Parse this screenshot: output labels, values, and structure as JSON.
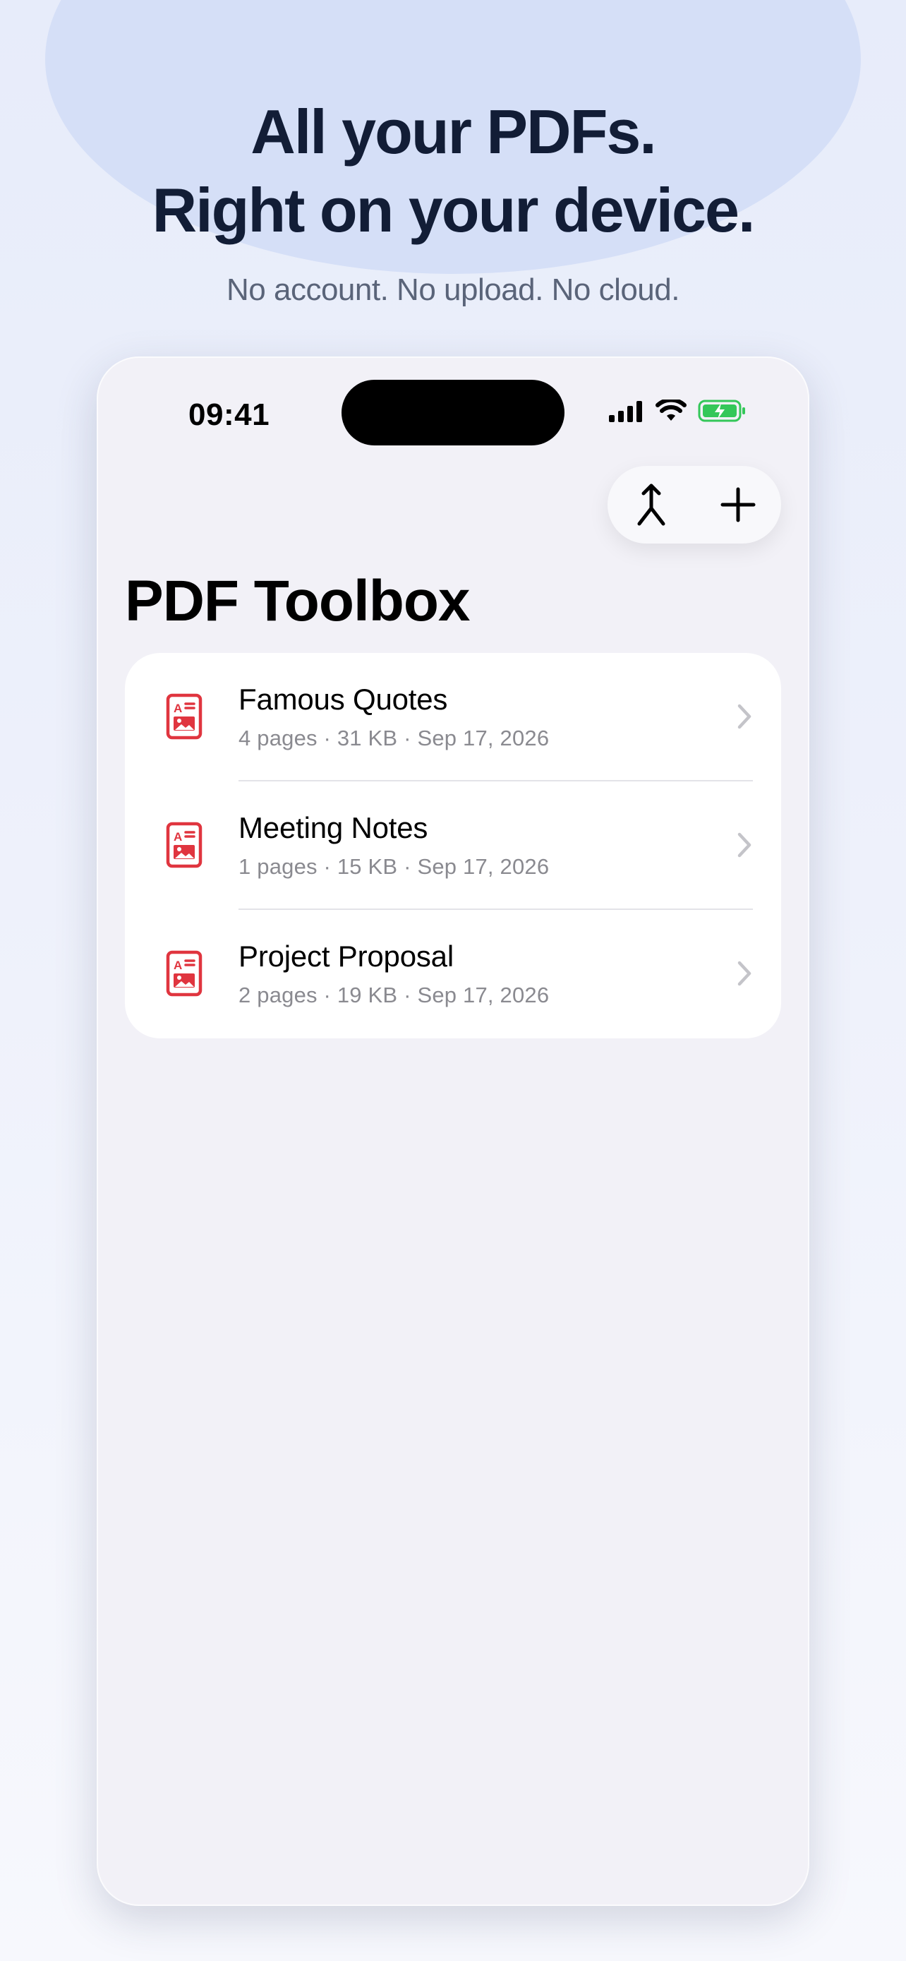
{
  "hero": {
    "headline_line1": "All your PDFs.",
    "headline_line2": "Right on your device.",
    "subheadline": "No account. No upload. No cloud."
  },
  "status_bar": {
    "time": "09:41",
    "icons": [
      "cellular-signal-icon",
      "wifi-icon",
      "battery-charging-icon"
    ]
  },
  "toolbar": {
    "merge_icon": "merge-arrow-icon",
    "add_icon": "plus-icon"
  },
  "screen": {
    "title": "PDF Toolbox"
  },
  "documents": [
    {
      "title": "Famous Quotes",
      "meta": "4 pages · 31 KB · Sep 17, 2026"
    },
    {
      "title": "Meeting Notes",
      "meta": "1 pages · 15 KB · Sep 17, 2026"
    },
    {
      "title": "Project Proposal",
      "meta": "2 pages · 19 KB · Sep 17, 2026"
    }
  ],
  "colors": {
    "accent_red": "#e0353f",
    "headline": "#121d36",
    "battery_green": "#34c759"
  }
}
